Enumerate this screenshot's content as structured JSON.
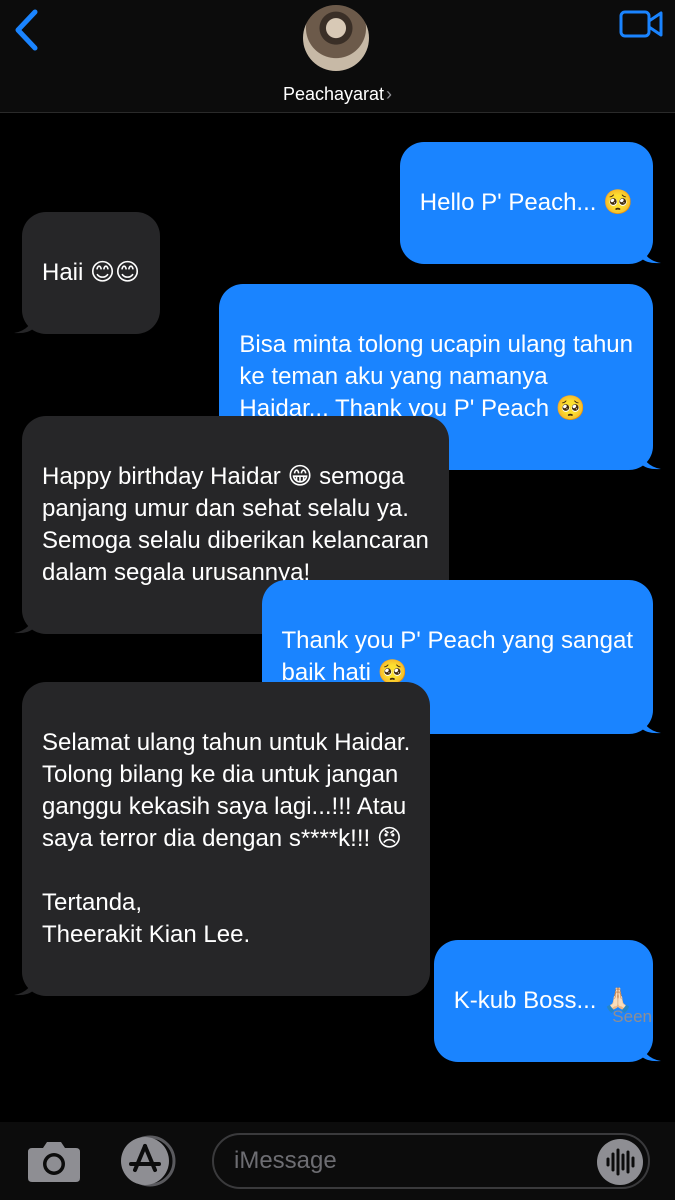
{
  "header": {
    "contact_name": "Peachayarat",
    "chevron": "›"
  },
  "messages": [
    {
      "id": "m1",
      "direction": "sent",
      "text": "Hello P' Peach... 🥺"
    },
    {
      "id": "m2",
      "direction": "received",
      "text": "Haii 😊😊"
    },
    {
      "id": "m3",
      "direction": "sent",
      "text": "Bisa minta tolong ucapin ulang tahun\nke teman aku yang namanya\nHaidar... Thank you P' Peach 🥺"
    },
    {
      "id": "m4",
      "direction": "received",
      "text": "Happy birthday Haidar 😁 semoga\npanjang umur dan sehat selalu ya.\nSemoga selalu diberikan kelancaran\ndalam segala urusannya!"
    },
    {
      "id": "m5",
      "direction": "sent",
      "text": "Thank you P' Peach yang sangat\nbaik hati 🥺"
    },
    {
      "id": "m6",
      "direction": "received",
      "text": "Selamat ulang tahun untuk Haidar.\nTolong bilang ke dia untuk jangan\nganggu kekasih saya lagi...!!! Atau\nsaya terror dia dengan s****k!!! 😠\n\nTertanda,\nTheerakit Kian Lee."
    },
    {
      "id": "m7",
      "direction": "sent",
      "text": "K-kub Boss... 🙏🏻"
    }
  ],
  "status": {
    "seen": "Seen"
  },
  "input": {
    "placeholder": "iMessage"
  },
  "icons": {
    "back": "chevron-left-icon",
    "video": "video-camera-icon",
    "camera": "camera-icon",
    "appstore": "app-store-icon",
    "audio": "audio-waveform-icon"
  },
  "colors": {
    "accent": "#1a84ff",
    "sent_bubble": "#1a84ff",
    "received_bubble": "#262628",
    "background": "#000000",
    "secondary_text": "#8e8e93"
  }
}
